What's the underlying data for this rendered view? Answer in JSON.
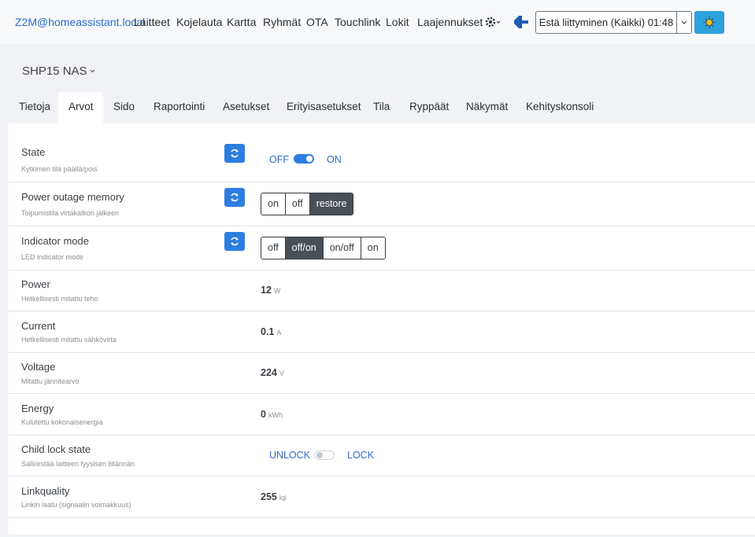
{
  "navbar": {
    "brand": "Z2M@homeassistant.local",
    "links": [
      "Laitteet",
      "Kojelauta",
      "Kartta",
      "Ryhmät",
      "OTA",
      "Touchlink",
      "Lokit",
      "Laajennukset"
    ],
    "settings_icon": "gear-icon",
    "language_icon": "finnish-flag-icon",
    "permit_join_label": "Estä liittyminen (Kaikki) 01:48",
    "theme_icon": "sun-icon",
    "colors": {
      "brand": "#2e6cd1",
      "theme_button": "#2da2dc"
    }
  },
  "device": {
    "name": "SHP15 NAS"
  },
  "tabs": [
    "Tietoja",
    "Arvot",
    "Sido",
    "Raportointi",
    "Asetukset",
    "Erityisasetukset",
    "Tila",
    "Ryppäät",
    "Näkymät",
    "Kehityskonsoli"
  ],
  "active_tab": "Arvot",
  "exposes": {
    "state": {
      "title": "State",
      "description": "Kytkimen tila päällä/pois",
      "off_label": "OFF",
      "on_label": "ON",
      "value": "ON"
    },
    "power_outage_memory": {
      "title": "Power outage memory",
      "description": "Toipumistila virtakatkon jälkeen",
      "options": [
        "on",
        "off",
        "restore"
      ],
      "selected": "restore"
    },
    "indicator_mode": {
      "title": "Indicator mode",
      "description": "LED indicator mode",
      "options": [
        "off",
        "off/on",
        "on/off",
        "on"
      ],
      "selected": "off/on"
    },
    "power": {
      "title": "Power",
      "description": "Hetkellisesti mitattu teho",
      "value": "12",
      "unit": "W"
    },
    "current": {
      "title": "Current",
      "description": "Hetkellisesti mitattu sähkövirta",
      "value": "0.1",
      "unit": "A"
    },
    "voltage": {
      "title": "Voltage",
      "description": "Mitattu jännitearvo",
      "value": "224",
      "unit": "V"
    },
    "energy": {
      "title": "Energy",
      "description": "Kulutettu kokonaisenergia",
      "value": "0",
      "unit": "kWh"
    },
    "child_lock": {
      "title": "Child lock state",
      "description": "Salli/estää laitteen fyysisen liitännän",
      "off_label": "UNLOCK",
      "on_label": "LOCK",
      "value": "UNLOCK"
    },
    "linkquality": {
      "title": "Linkquality",
      "description": "Linkin laatu (signaalin voimakkuus)",
      "value": "255",
      "unit": "lqi"
    }
  },
  "colors": {
    "toggle_on": "#2d7ee0",
    "toggle_off": "#d9dcdf",
    "refresh_button": "#2d7ee0",
    "segment_active": "#495057"
  }
}
